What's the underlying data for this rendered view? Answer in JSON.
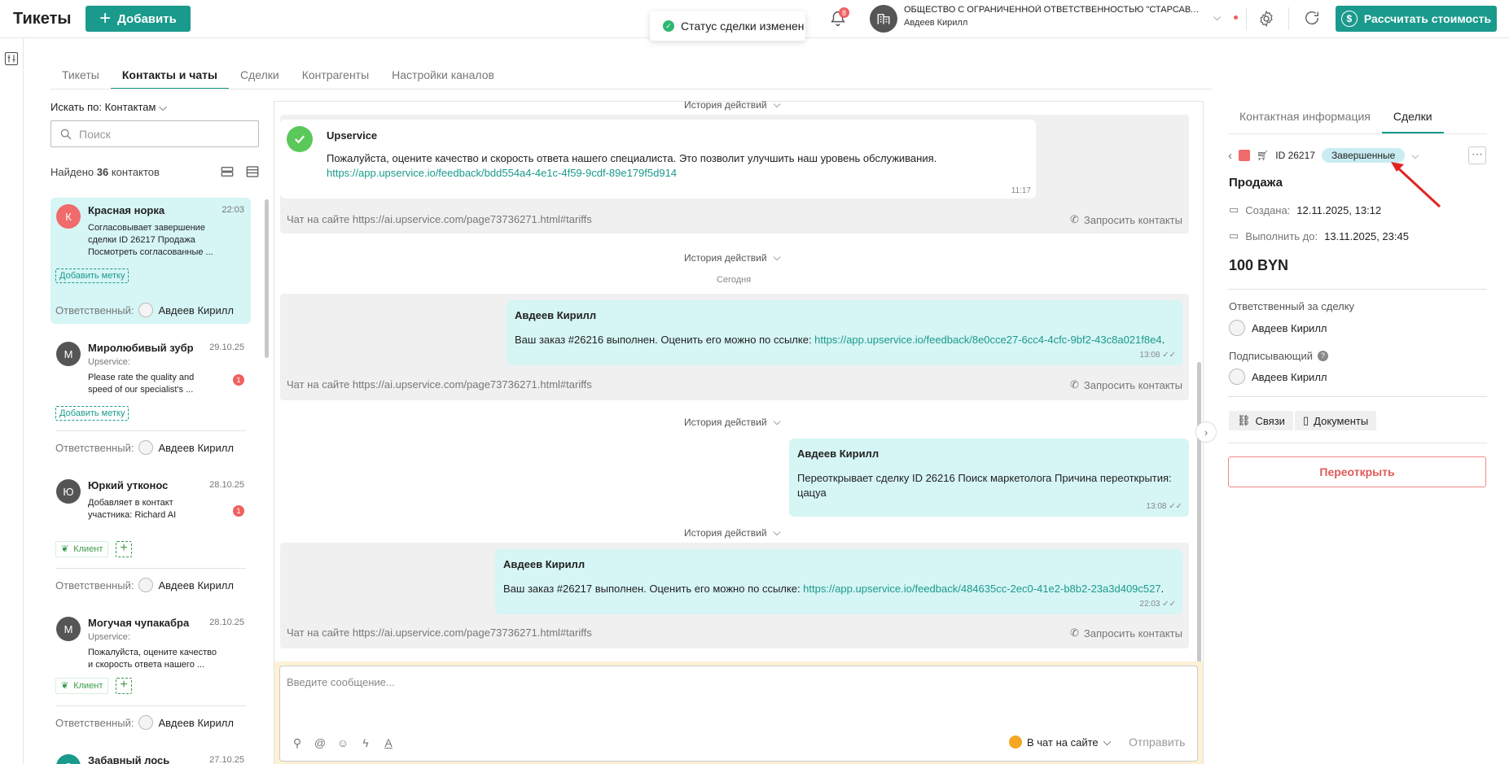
{
  "header": {
    "title": "Тикеты",
    "add_label": "Добавить",
    "toast": "Статус сделки изменен",
    "notifications_count": "8",
    "org_name": "ОБЩЕСТВО С ОГРАНИЧЕННОЙ ОТВЕТСТВЕННОСТЬЮ \"СТАРСАВТО\"...",
    "org_user": "Авдеев Кирилл",
    "calc_label": "Рассчитать стоимость"
  },
  "tabs": [
    "Тикеты",
    "Контакты и чаты",
    "Сделки",
    "Контрагенты",
    "Настройки каналов"
  ],
  "search": {
    "by_label": "Искать по: Контактам",
    "placeholder": "Поиск",
    "found_prefix": "Найдено",
    "found_count": "36",
    "found_suffix": "контактов"
  },
  "contacts": [
    {
      "initial": "К",
      "name": "Красная норка",
      "date": "22:03",
      "sub": "",
      "text": "Согласовывает завершение сделки ID 26217 Продажа Посмотреть согласованные ...",
      "tag": "Добавить метку",
      "resp_label": "Ответственный:",
      "resp_name": "Авдеев Кирилл"
    },
    {
      "initial": "М",
      "name": "Миролюбивый зубр",
      "date": "29.10.25",
      "sub": "Upservice:",
      "text": "Please rate the quality and speed of our specialist's ...",
      "unread": "1",
      "tag": "Добавить метку",
      "resp_label": "Ответственный:",
      "resp_name": "Авдеев Кирилл"
    },
    {
      "initial": "Ю",
      "name": "Юркий утконос",
      "date": "28.10.25",
      "sub": "",
      "text": "Добавляет в контакт участника: Richard AI",
      "unread": "1",
      "chip": "Клиент",
      "resp_label": "Ответственный:",
      "resp_name": "Авдеев Кирилл"
    },
    {
      "initial": "М",
      "name": "Могучая чупакабра",
      "date": "28.10.25",
      "sub": "Upservice:",
      "text": "Пожалуйста, оцените качество и скорость ответа нашего ...",
      "chip": "Клиент",
      "resp_label": "Ответственный:",
      "resp_name": "Авдеев Кирилл"
    },
    {
      "initial": "З",
      "name": "Забавный лось",
      "date": "27.10.25"
    }
  ],
  "chat": {
    "history_label": "История действий",
    "today_label": "Сегодня",
    "channel": "Чат на сайте https://ai.upservice.com/page73736271.html#tariffs",
    "request_contacts": "Запросить контакты",
    "messages": [
      {
        "author": "Upservice",
        "text": "Пожалуйста, оцените качество и скорость ответа нашего специалиста. Это позволит улучшить наш уровень обслуживания.",
        "link": "https://app.upservice.io/feedback/bdd554a4-4e1c-4f59-9cdf-89e179f5d914",
        "time": "11:17"
      },
      {
        "author": "Авдеев Кирилл",
        "text": "Ваш заказ #26216 выполнен. Оценить его можно по ссылке: ",
        "link": "https://app.upservice.io/feedback/8e0cce27-6cc4-4cfc-9bf2-43c8a021f8e4",
        "time": "13:08"
      },
      {
        "author": "Авдеев Кирилл",
        "text": "Переоткрывает сделку ID 26216 Поиск маркетолога Причина переоткрытия: цацуа",
        "time": "13:08"
      },
      {
        "author": "Авдеев Кирилл",
        "text": "Ваш заказ #26217 выполнен. Оценить его можно по ссылке: ",
        "link": "https://app.upservice.io/feedback/484635cc-2ec0-41e2-b8b2-23a3d409c527",
        "time": "22:03"
      }
    ]
  },
  "composer": {
    "placeholder": "Введите сообщение...",
    "send_to": "В чат на сайте",
    "send_label": "Отправить"
  },
  "deal_panel": {
    "tabs": [
      "Контактная информация",
      "Сделки"
    ],
    "deal_id": "ID 26217",
    "status": "Завершенные",
    "title": "Продажа",
    "created_label": "Создана:",
    "created_value": "12.11.2025, 13:12",
    "due_label": "Выполнить до:",
    "due_value": "13.11.2025, 23:45",
    "price": "100 BYN",
    "responsible_label": "Ответственный за сделку",
    "responsible_name": "Авдеев Кирилл",
    "signer_label": "Подписывающий",
    "signer_name": "Авдеев Кирилл",
    "links_label": "Связи",
    "docs_label": "Документы",
    "reopen_label": "Переоткрыть"
  },
  "colors": {
    "accent": "#1a9a8c",
    "bubble": "#d6f5f5",
    "danger": "#e05a5a",
    "status_pill": "#c9ecf2"
  }
}
